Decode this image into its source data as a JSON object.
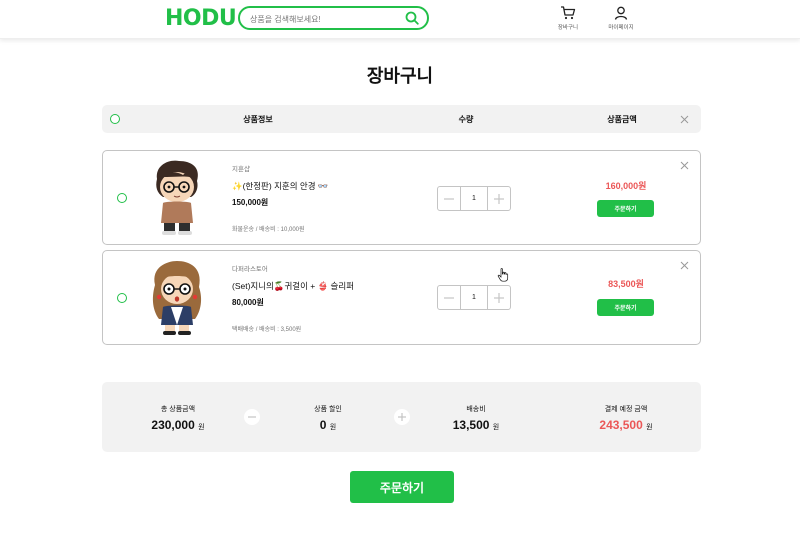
{
  "header": {
    "logo": "HODU",
    "search_placeholder": "상품을 검색해보세요!",
    "cart_label": "장바구니",
    "mypage_label": "마이페이지"
  },
  "page_title": "장바구니",
  "columns": {
    "product_info": "상품정보",
    "quantity": "수량",
    "price": "상품금액"
  },
  "items": [
    {
      "seller": "지훈샵",
      "name": "✨(한정판) 지훈의 안경 👓",
      "price": "150,000원",
      "shipping": "화물운송 / 배송비 : 10,000원",
      "quantity": "1",
      "total": "160,000원",
      "order_label": "주문하기"
    },
    {
      "seller": "다퍼라스토어",
      "name": "(Set)지니의🍒귀걸이 + 👙 슬리퍼",
      "price": "80,000원",
      "shipping": "택배배송 / 배송비 : 3,500원",
      "quantity": "1",
      "total": "83,500원",
      "order_label": "주문하기"
    }
  ],
  "summary": {
    "total_label": "총 상품금액",
    "total_value": "230,000",
    "discount_label": "상품 할인",
    "discount_value": "0",
    "shipping_label": "배송비",
    "shipping_value": "13,500",
    "payment_label": "결제 예정 금액",
    "payment_value": "243,500",
    "unit": "원"
  },
  "order_all_label": "주문하기",
  "colors": {
    "brand": "#21bf48",
    "accent_red": "#eb5757",
    "border": "#c4c4c4",
    "panel_bg": "#f2f2f2"
  },
  "icons": [
    "search-icon",
    "cart-icon",
    "user-icon",
    "close-icon",
    "minus-icon",
    "plus-icon",
    "pointer-cursor-icon"
  ]
}
